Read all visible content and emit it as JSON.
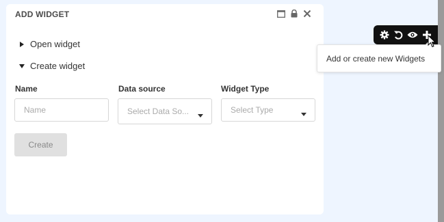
{
  "panel": {
    "title": "ADD WIDGET",
    "header_icons": [
      "maximize-icon",
      "lock-icon",
      "close-icon"
    ]
  },
  "sections": {
    "open_label": "Open widget",
    "create_label": "Create widget"
  },
  "form": {
    "name_label": "Name",
    "name_placeholder": "Name",
    "source_label": "Data source",
    "source_placeholder": "Select Data So...",
    "type_label": "Widget Type",
    "type_placeholder": "Select Type",
    "create_button": "Create"
  },
  "toolbar": {
    "icons": [
      "gear-icon",
      "undo-icon",
      "eye-icon",
      "plus-icon"
    ]
  },
  "tooltip": {
    "text": "Add or create new Widgets"
  },
  "colors": {
    "background": "#eef5ff",
    "toolbar": "#111111",
    "panel": "#ffffff",
    "button_disabled": "#e0e0e0"
  }
}
